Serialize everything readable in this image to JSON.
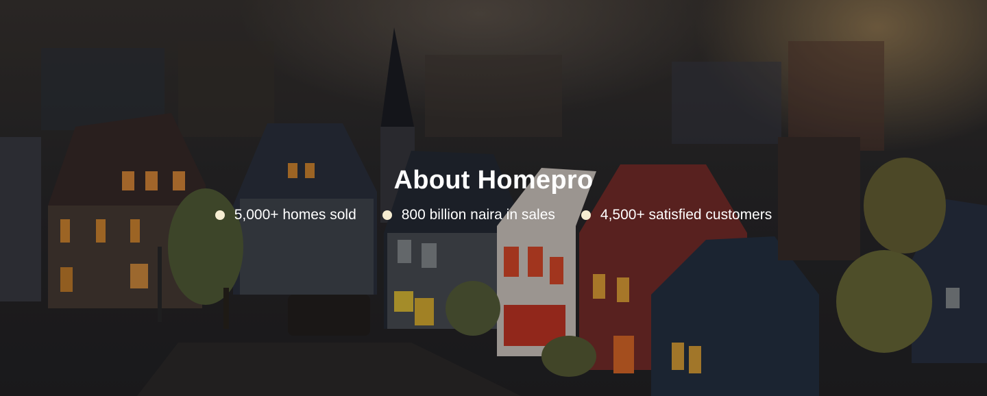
{
  "hero": {
    "title": "About Homepro",
    "stats": [
      {
        "label": "5,000+ homes sold",
        "icon": "bullet-dot-icon"
      },
      {
        "label": "800 billion naira in sales",
        "icon": "bullet-dot-icon"
      },
      {
        "label": "4,500+ satisfied customers",
        "icon": "bullet-dot-icon"
      }
    ]
  },
  "colors": {
    "text": "#ffffff",
    "bullet": "#f6edd2"
  }
}
